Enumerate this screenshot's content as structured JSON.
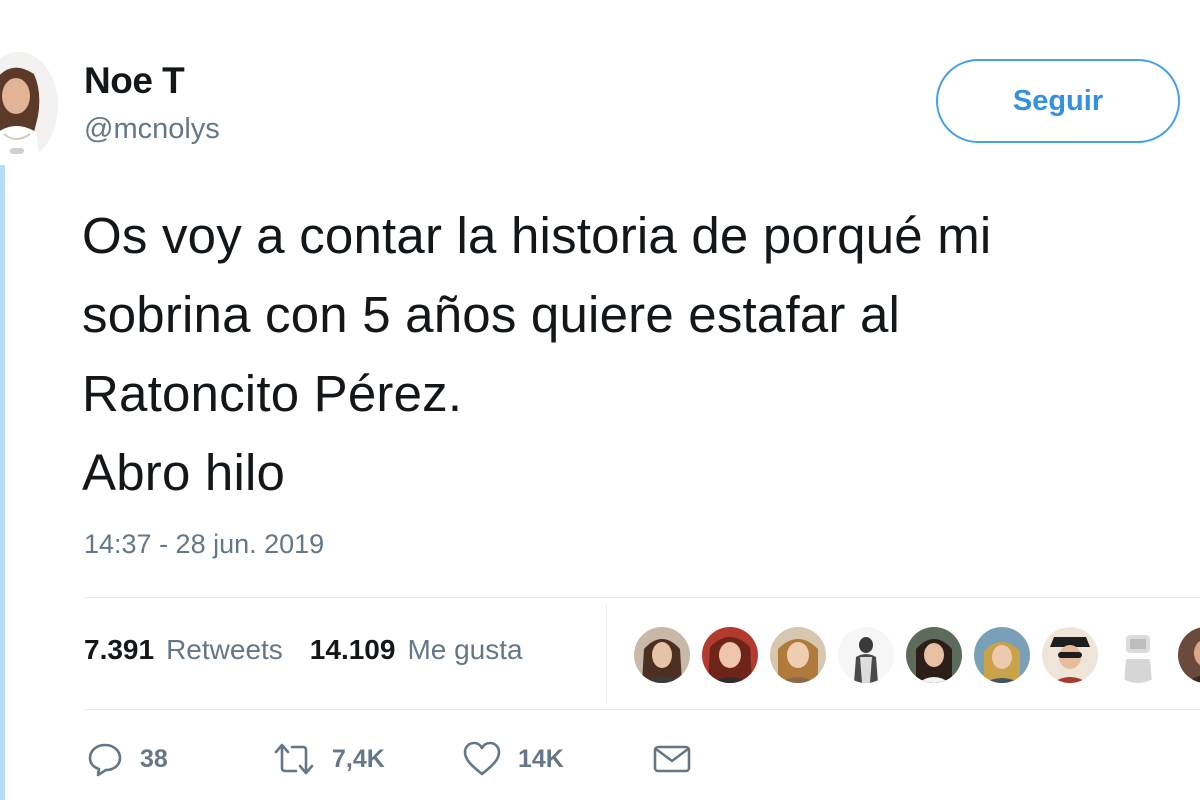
{
  "author": {
    "name": "Noe T",
    "handle": "@mcnolys"
  },
  "follow_button": {
    "label": "Seguir"
  },
  "tweet": {
    "lines": [
      "Os voy a contar la historia de porqué mi",
      "sobrina con 5 años quiere estafar al",
      "Ratoncito Pérez.",
      "Abro hilo"
    ],
    "timestamp": "14:37 - 28 jun. 2019"
  },
  "stats": {
    "retweets_count": "7.391",
    "retweets_label": "Retweets",
    "likes_count": "14.109",
    "likes_label": "Me gusta"
  },
  "liker_avatars": [
    "liker-avatar",
    "liker-avatar",
    "liker-avatar",
    "liker-avatar",
    "liker-avatar",
    "liker-avatar",
    "liker-avatar",
    "liker-avatar",
    "liker-avatar"
  ],
  "actions": {
    "reply_count": "38",
    "retweet_count": "7,4K",
    "like_count": "14K"
  },
  "colors": {
    "accent": "#1da1f2",
    "thread_line": "#b7ddf5",
    "text_primary": "#14171a",
    "text_secondary": "#657786"
  }
}
